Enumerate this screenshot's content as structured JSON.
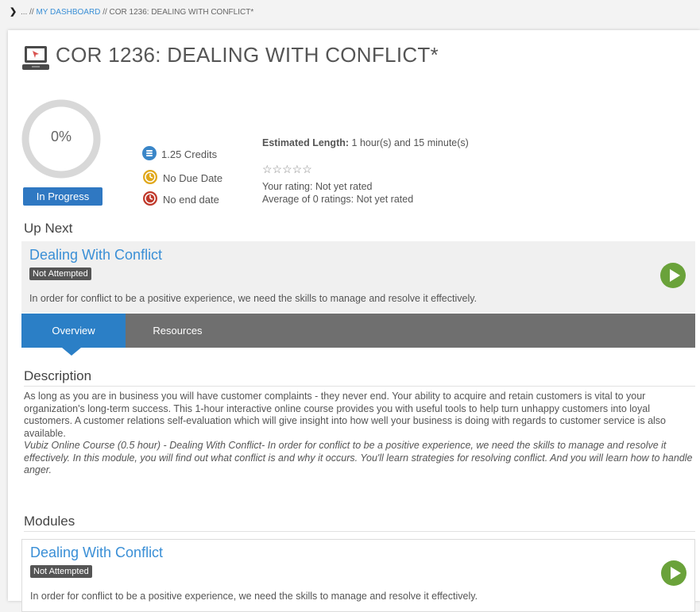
{
  "breadcrumb": {
    "prefix": "... //",
    "dashboard": "MY DASHBOARD",
    "separator": "//",
    "current": "COR 1236: DEALING WITH CONFLICT*"
  },
  "course": {
    "title": "COR 1236: DEALING WITH CONFLICT*",
    "progress_text": "0%",
    "progress_fraction": 0,
    "status": "In Progress",
    "credits": "1.25 Credits",
    "due_date": "No Due Date",
    "end_date": "No end date",
    "estimated_label": "Estimated Length:",
    "estimated_value": "1 hour(s) and 15 minute(s)",
    "stars": "☆☆☆☆☆",
    "your_rating": "Your rating: Not yet rated",
    "average_rating": "Average of 0 ratings: Not yet rated"
  },
  "up_next": {
    "heading": "Up Next",
    "title": "Dealing With Conflict",
    "tag": "Not Attempted",
    "description": "In order for conflict to be a positive experience, we need the skills to manage and resolve it effectively."
  },
  "tabs": [
    {
      "label": "Overview",
      "active": true
    },
    {
      "label": "Resources",
      "active": false
    }
  ],
  "description": {
    "heading": "Description",
    "paragraph1": "As long as you are in business you will have customer complaints - they never end. Your ability to acquire and retain customers is vital to your organization's long-term success. This 1-hour interactive online course provides you with useful tools to help turn unhappy customers into loyal customers. A customer relations self-evaluation which will give insight into how well your business is doing with regards to customer service is also available.",
    "paragraph2": "Vubiz Online Course (0.5 hour) - Dealing With Conflict- In order for conflict to be a positive experience, we need the skills to manage and resolve it effectively. In this module, you will find out what conflict is and why it occurs. You'll learn strategies for resolving conflict. And you will learn how to handle anger."
  },
  "modules": {
    "heading": "Modules",
    "items": [
      {
        "title": "Dealing With Conflict",
        "tag": "Not Attempted",
        "description": "In order for conflict to be a positive experience, we need the skills to manage and resolve it effectively."
      }
    ]
  },
  "colors": {
    "accent_blue": "#2f78c2",
    "link_blue": "#3a8fd6",
    "play_green": "#6aa23a",
    "tab_bar": "#6f6f6f",
    "credits_icon": "#3a86c8",
    "due_icon": "#e0a81c",
    "end_icon": "#c0392b"
  },
  "icons": {
    "course": "laptop-icon",
    "credits": "credits-icon",
    "due": "clock-icon",
    "end": "end-clock-icon",
    "play": "play-icon",
    "breadcrumb": "chevron-right-icon"
  }
}
